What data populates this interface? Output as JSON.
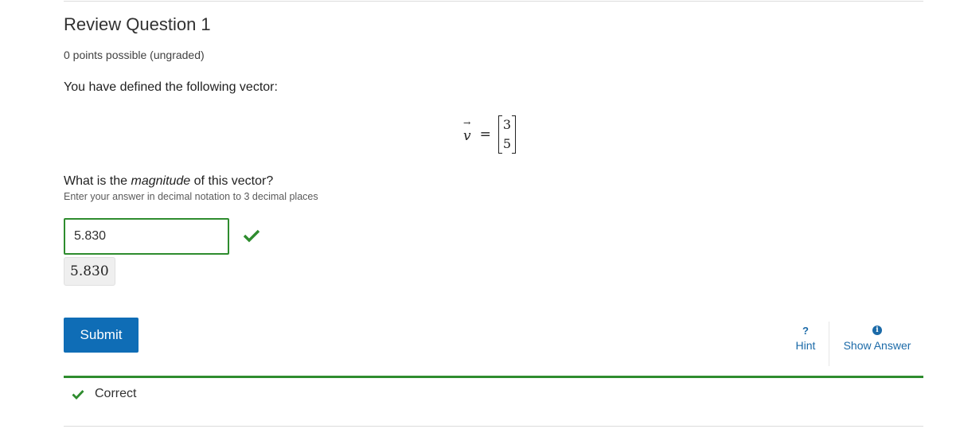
{
  "problem": {
    "title": "Review Question 1",
    "points": "0 points possible (ungraded)",
    "prompt": "You have defined the following vector:",
    "vector": {
      "variable": "v",
      "arrow": "→",
      "equals": "=",
      "entries": [
        "3",
        "5"
      ]
    },
    "question_before": "What is the ",
    "question_emph": "magnitude",
    "question_after": " of this vector?",
    "instruction": "Enter your answer in decimal notation to 3 decimal places"
  },
  "answer": {
    "value": "5.830",
    "preview": "5.830",
    "status_color": "#2e8c2e"
  },
  "actions": {
    "submit_label": "Submit",
    "hint_label": "Hint",
    "hint_icon": "?",
    "show_answer_label": "Show Answer",
    "show_answer_icon": "i",
    "accent_color": "#0f6db6"
  },
  "feedback": {
    "label": "Correct"
  }
}
